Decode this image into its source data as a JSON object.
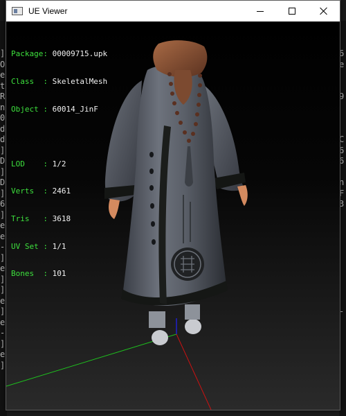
{
  "window": {
    "title": "UE Viewer",
    "controls": {
      "minimize": "minimize-icon",
      "maximize": "maximize-icon",
      "close": "close-icon"
    }
  },
  "info": {
    "package_label": "Package:",
    "package": "00009715.upk",
    "class_label": "Class  :",
    "class": "SkeletalMesh",
    "object_label": "Object :",
    "object": "60014_JinF",
    "lod_label": "LOD    :",
    "lod": "1/2",
    "verts_label": "Verts  :",
    "verts": "2461",
    "tris_label": "Tris   :",
    "tris": "3618",
    "uvset_label": "UV Set :",
    "uvset": "1/1",
    "bones_label": "Bones  :",
    "bones": "101"
  },
  "background_console": {
    "left": [
      "]",
      "O",
      "e",
      "t",
      "R",
      "n",
      "0",
      "d",
      "d",
      "]",
      "D",
      "]",
      "D",
      "]",
      "6",
      "]",
      "e",
      "e",
      "-",
      "]",
      "e",
      "]",
      "]",
      "e",
      "]",
      "e",
      "-",
      "]",
      "e",
      "]"
    ],
    "right": [
      "6",
      "e",
      "",
      "",
      "9",
      "",
      "",
      "",
      "C",
      "6",
      "6",
      "",
      "n",
      "F",
      "3",
      "",
      "",
      "",
      "",
      "",
      "",
      "",
      "",
      "",
      "-",
      "",
      "",
      ""
    ]
  },
  "colors": {
    "label_green": "#3de03d",
    "value_white": "#f2f2f2",
    "axis_x": "#cc1111",
    "axis_y": "#1ec21e",
    "axis_z": "#2020cc"
  }
}
